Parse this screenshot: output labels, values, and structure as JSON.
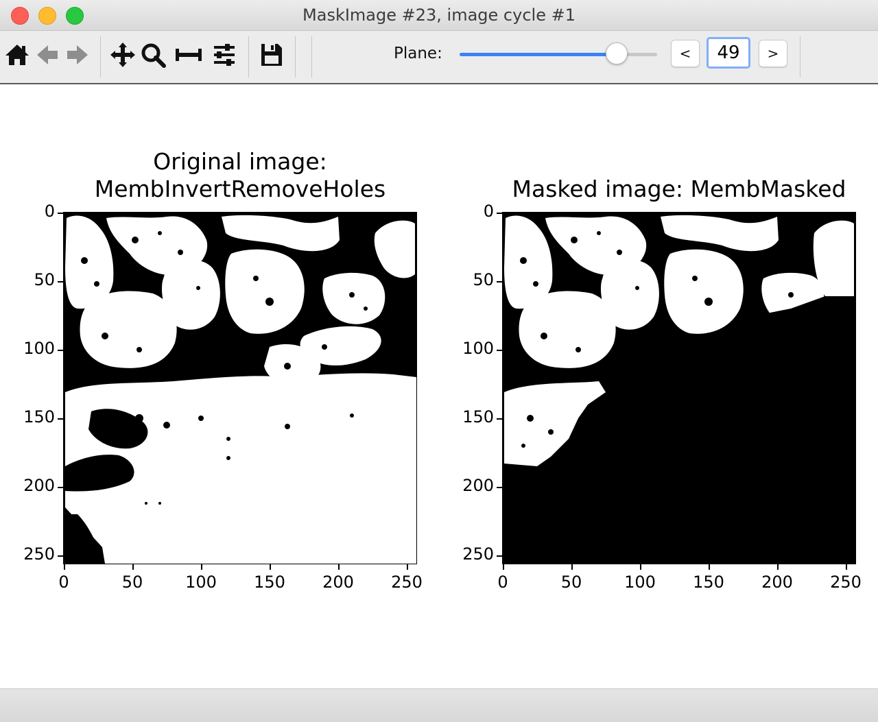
{
  "window": {
    "title": "MaskImage #23, image cycle #1"
  },
  "toolbar": {
    "icons": [
      "home-icon",
      "back-arrow-icon",
      "forward-arrow-icon",
      "pan-move-icon",
      "zoom-magnifier-icon",
      "subplot-spacing-icon",
      "configure-sliders-icon",
      "save-floppy-icon"
    ],
    "plane_label": "Plane:",
    "plane_value": "49",
    "slider_fraction": 0.79,
    "prev_label": "<",
    "next_label": ">",
    "accent_color": "#3b82f6"
  },
  "figure": {
    "left_panel": {
      "title_line1": "Original image:",
      "title_line2": "MembInvertRemoveHoles"
    },
    "right_panel": {
      "title": "Masked image: MembMasked"
    },
    "y_ticks": [
      "0",
      "50",
      "100",
      "150",
      "200",
      "250"
    ],
    "x_ticks": [
      "0",
      "50",
      "100",
      "150",
      "200",
      "250"
    ]
  }
}
